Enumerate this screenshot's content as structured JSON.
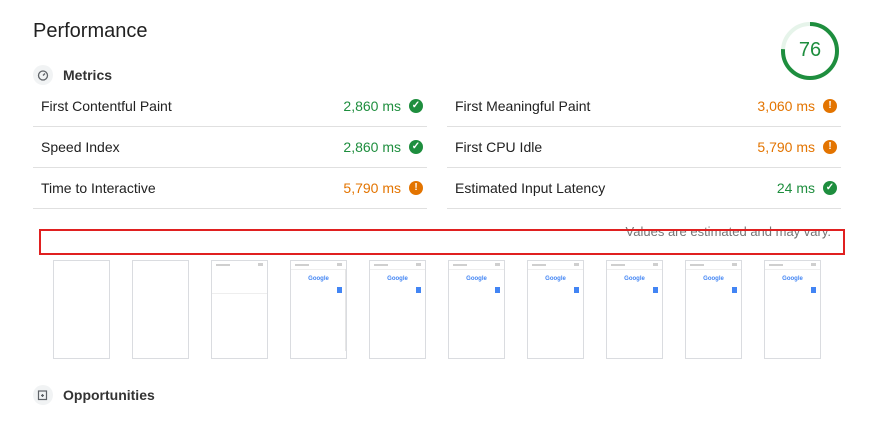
{
  "title": "Performance",
  "score": {
    "value": "76",
    "fraction": 0.76,
    "color": "#1e8e3e"
  },
  "sections": {
    "metrics": "Metrics",
    "opportunities": "Opportunities"
  },
  "icons": {
    "metrics": "timer-icon",
    "opportunities": "opportunity-icon",
    "pass": "check-circle-icon",
    "average": "info-circle-icon"
  },
  "status_colors": {
    "pass": "#1e8e3e",
    "average": "#e37400"
  },
  "metrics": [
    {
      "name": "First Contentful Paint",
      "value": "2,860 ms",
      "status": "pass"
    },
    {
      "name": "First Meaningful Paint",
      "value": "3,060 ms",
      "status": "average"
    },
    {
      "name": "Speed Index",
      "value": "2,860 ms",
      "status": "pass"
    },
    {
      "name": "First CPU Idle",
      "value": "5,790 ms",
      "status": "average"
    },
    {
      "name": "Time to Interactive",
      "value": "5,790 ms",
      "status": "average"
    },
    {
      "name": "Estimated Input Latency",
      "value": "24 ms",
      "status": "pass"
    }
  ],
  "footnote": "Values are estimated and may vary.",
  "filmstrip": {
    "logo_text": "Google",
    "frame_states": [
      "blank",
      "blank",
      "loading",
      "rendered",
      "rendered",
      "rendered",
      "rendered",
      "rendered",
      "rendered",
      "rendered"
    ]
  }
}
